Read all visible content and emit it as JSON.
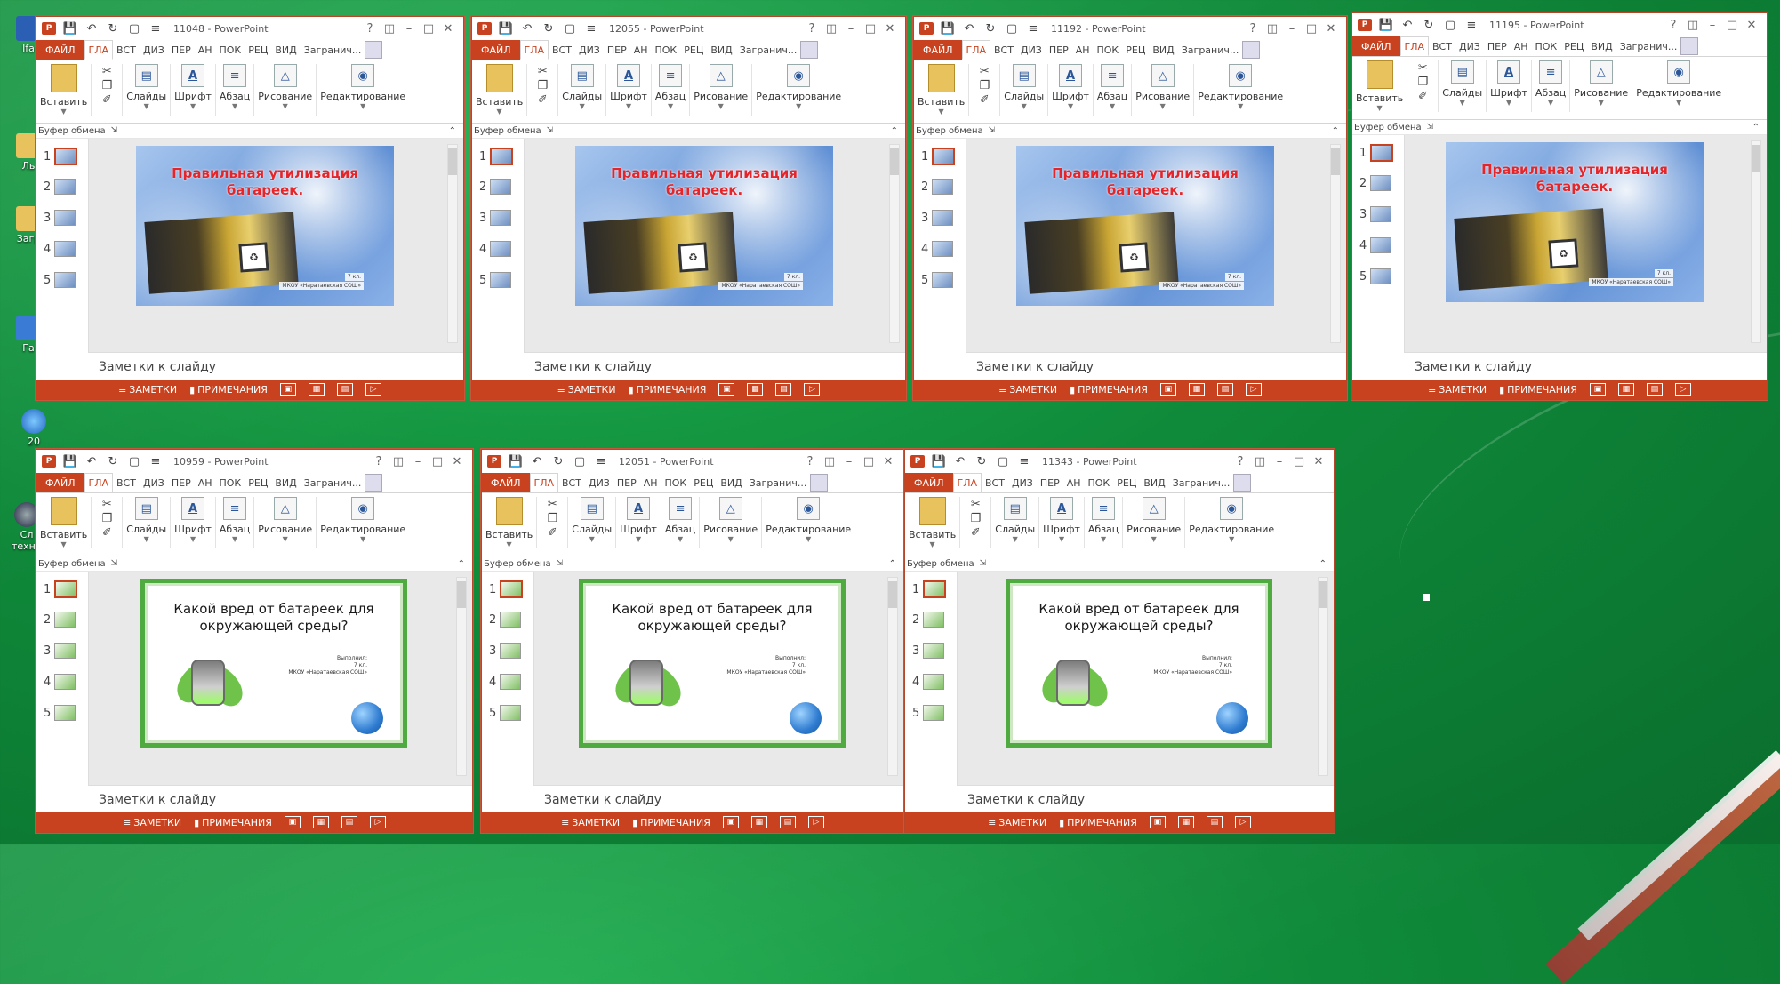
{
  "desktop": {
    "icons": [
      {
        "label": "Ifa"
      },
      {
        "label": "Ль"
      },
      {
        "label": "Загр"
      },
      {
        "label": "Га"
      },
      {
        "label": "20"
      },
      {
        "label": "Сл техни"
      }
    ]
  },
  "common": {
    "tabs": {
      "file": "ФАЙЛ",
      "home": "ГЛА",
      "insert": "ВСТ",
      "design": "ДИЗ",
      "transitions": "ПЕР",
      "animations": "АН",
      "slideshow": "ПОК",
      "review": "РЕЦ",
      "view": "ВИД",
      "user": "Загранич..."
    },
    "ribbon": {
      "paste": "Вставить",
      "slides": "Слайды",
      "font": "Шрифт",
      "paragraph": "Абзац",
      "drawing": "Рисование",
      "editing": "Редактирование",
      "clipboard": "Буфер обмена"
    },
    "notes_placeholder": "Заметки к слайду",
    "status": {
      "notes": "ЗАМЕТКИ",
      "comments": "ПРИМЕЧАНИЯ"
    },
    "thumb_numbers": [
      "1",
      "2",
      "3",
      "4",
      "5"
    ]
  },
  "slides": {
    "blue": {
      "title_line1": "Правильная утилизация",
      "title_line2": "батареек.",
      "caption": "МКОУ «Наратаевская СОШ»",
      "class": "7 кл."
    },
    "green": {
      "title_line1": "Какой вред от батареек для",
      "title_line2": "окружающей среды?",
      "performed": "Выполнил:",
      "class": "7 кл.",
      "school": "МКОУ «Наратаевская СОШ»"
    }
  },
  "windows": [
    {
      "title": "11048 - PowerPoint",
      "type": "blue"
    },
    {
      "title": "12055 - PowerPoint",
      "type": "blue"
    },
    {
      "title": "11192 - PowerPoint",
      "type": "blue"
    },
    {
      "title": "11195 - PowerPoint",
      "type": "blue"
    },
    {
      "title": "10959 - PowerPoint",
      "type": "green"
    },
    {
      "title": "12051 - PowerPoint",
      "type": "green"
    },
    {
      "title": "11343 - PowerPoint",
      "type": "green"
    }
  ],
  "colors": {
    "accent": "#c9421f",
    "desktop_green": "#0f8a3a"
  }
}
